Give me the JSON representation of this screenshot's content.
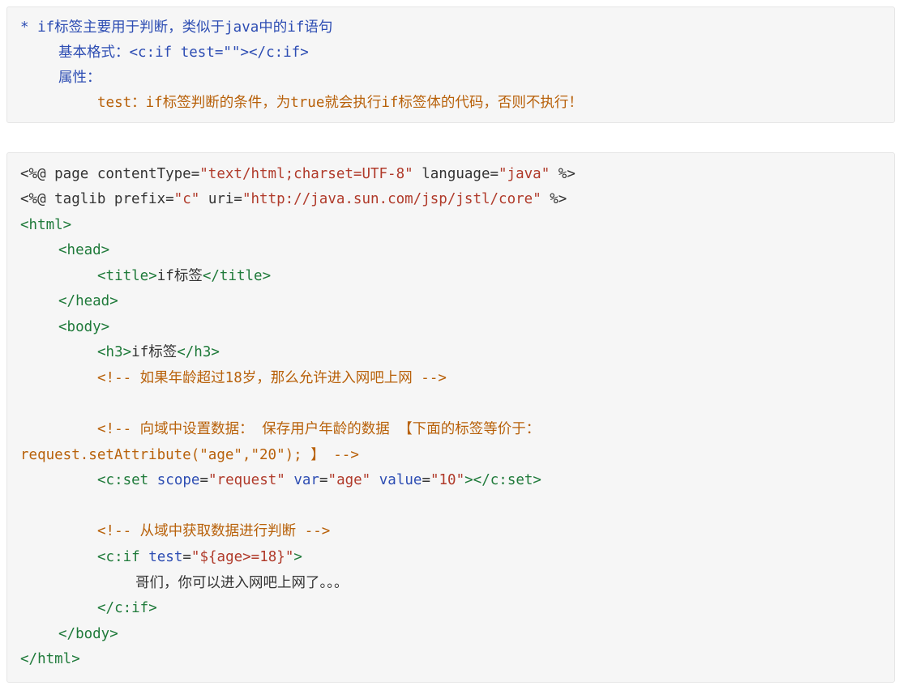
{
  "note": {
    "line1": "* if标签主要用于判断，类似于java中的if语句",
    "line2": "基本格式：<c:if test=\"\"></c:if>",
    "line3": "属性：",
    "line4": "test：if标签判断的条件，为true就会执行if标签体的代码，否则不执行！"
  },
  "code": {
    "l1": {
      "a": "<%@ page ",
      "b": "contentType=",
      "c": "\"text/html;charset=UTF-8\"",
      "d": " language=",
      "e": "\"java\"",
      "f": " %>"
    },
    "l2": {
      "a": "<%@ taglib ",
      "b": "prefix=",
      "c": "\"c\"",
      "d": " uri=",
      "e": "\"http://java.sun.com/jsp/jstl/core\"",
      "f": " %>"
    },
    "l3": "<html>",
    "l4": "<head>",
    "l5": {
      "open": "<title>",
      "text": "if标签",
      "close": "</title>"
    },
    "l6": "</head>",
    "l7": "<body>",
    "l8": {
      "open": "<h3>",
      "text": "if标签",
      "close": "</h3>"
    },
    "l9": "<!-- 如果年龄超过18岁，那么允许进入网吧上网 -->",
    "l11": "<!-- 向域中设置数据： 保存用户年龄的数据 【下面的标签等价于：",
    "l12": "request.setAttribute(\"age\",\"20\"); 】 -->",
    "l13": {
      "open": "<c:set ",
      "a1": "scope",
      "eq1": "=",
      "v1": "\"request\"",
      "a2": " var",
      "eq2": "=",
      "v2": "\"age\"",
      "a3": " value",
      "eq3": "=",
      "v3": "\"10\"",
      "close": "></c:set>"
    },
    "l15": "<!-- 从域中获取数据进行判断 -->",
    "l16": {
      "open": "<c:if ",
      "a1": "test",
      "eq1": "=",
      "v1": "\"${age>=18}\"",
      "close": ">"
    },
    "l17": "哥们，你可以进入网吧上网了。。。",
    "l18": "</c:if>",
    "l19": "</body>",
    "l20": "</html>"
  }
}
